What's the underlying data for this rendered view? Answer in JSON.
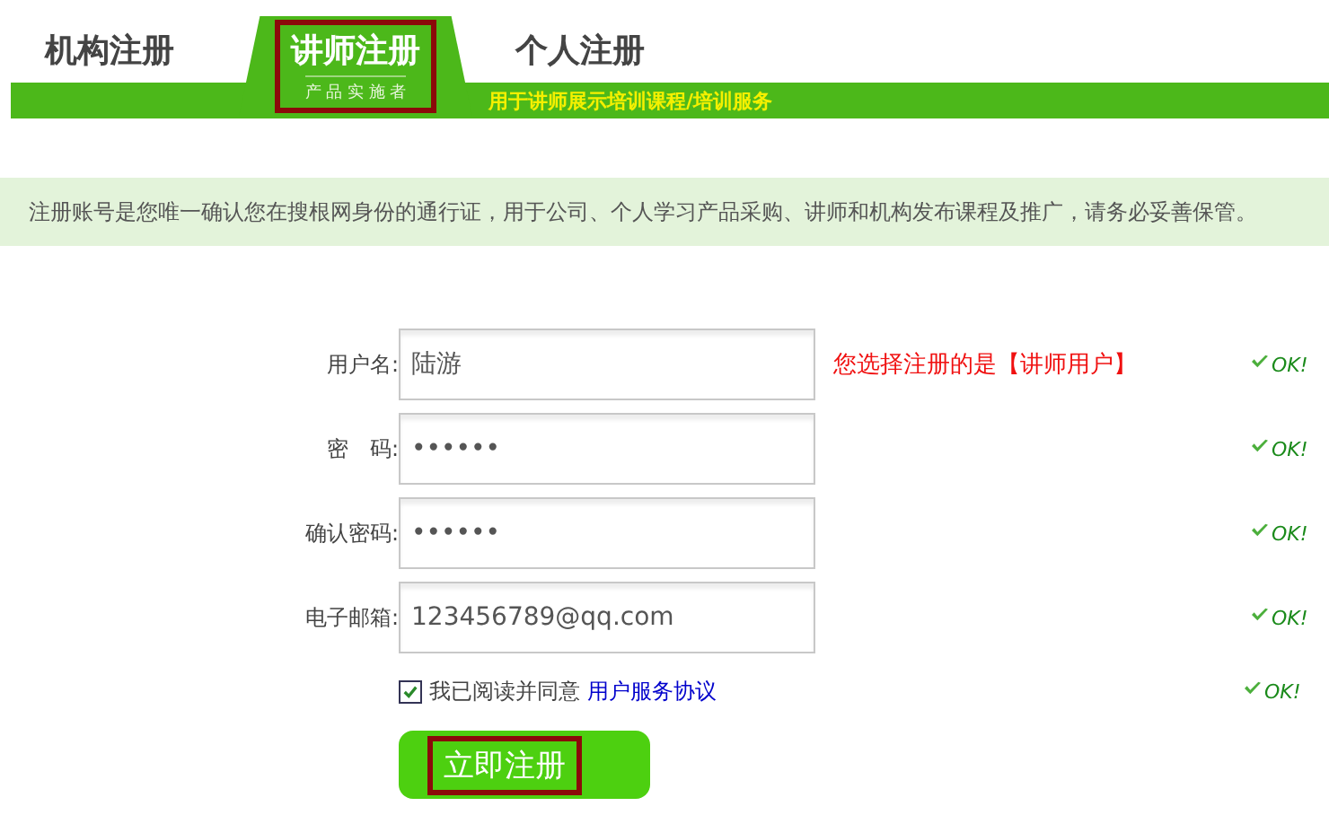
{
  "tabs": [
    {
      "label": "机构注册",
      "selected": false,
      "highlighted": false
    },
    {
      "label": "讲师注册",
      "subtitle": "产 品 实 施 者",
      "selected": true,
      "highlighted": true
    },
    {
      "label": "个人注册",
      "selected": false,
      "highlighted": false
    }
  ],
  "tab_bar_caption": "用于讲师展示培训课程/培训服务",
  "notice": "注册账号是您唯一确认您在搜根网身份的通行证，用于公司、个人学习产品采购、讲师和机构发布课程及推广，请务必妥善保管。",
  "fields": [
    {
      "label": "用户名:",
      "value": "陆游",
      "message": "您选择注册的是【讲师用户】",
      "status": "OK!",
      "valid": true
    },
    {
      "label": "密　码:",
      "value": "••••••",
      "status": "OK!",
      "valid": true
    },
    {
      "label": "确认密码:",
      "value": "••••••",
      "status": "OK!",
      "valid": true
    },
    {
      "label": "电子邮箱:",
      "value": "123456789@qq.com",
      "status": "OK!",
      "valid": true
    }
  ],
  "agreement": {
    "text": "我已阅读并同意",
    "link": "用户服务协议",
    "checked": true,
    "status": "OK!",
    "valid": true
  },
  "submit": {
    "label": "立即注册",
    "highlighted": true
  }
}
